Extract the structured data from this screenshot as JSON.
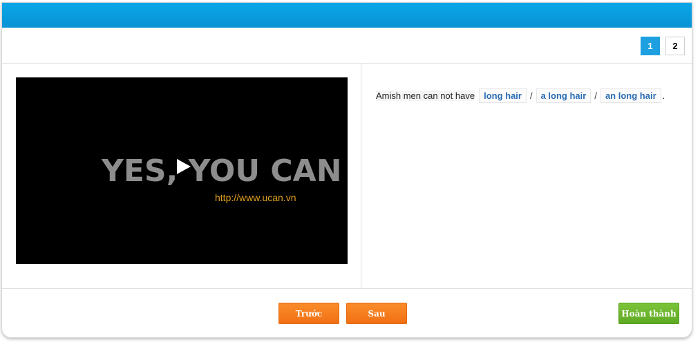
{
  "colors": {
    "header": "#0a9ee0",
    "active_page": "#1ea0e0",
    "nav_button": "#f57a1c",
    "finish_button": "#6ab62c",
    "option_text": "#2a6cb3"
  },
  "pager": {
    "pages": [
      "1",
      "2"
    ],
    "current": "1"
  },
  "video": {
    "title": "YES, YOU CAN",
    "url": "http://www.ucan.vn",
    "control_icon": "play-icon"
  },
  "question": {
    "prefix": "Amish men can not have",
    "options": [
      "long hair",
      "a long hair",
      "an long hair"
    ],
    "separator": "/",
    "suffix": "."
  },
  "footer": {
    "prev_label": "Trước",
    "next_label": "Sau",
    "finish_label": "Hoàn thành"
  }
}
